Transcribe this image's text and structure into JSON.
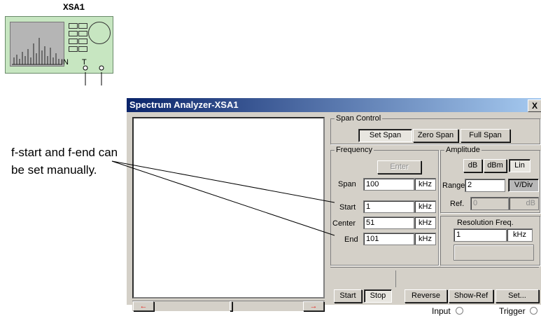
{
  "instrument": {
    "label": "XSA1",
    "terminal_in": "IN",
    "terminal_t": "T"
  },
  "window": {
    "title": "Spectrum Analyzer-XSA1",
    "close_label": "X",
    "span_control": {
      "legend": "Span Control",
      "buttons": [
        {
          "label": "Set Span",
          "active": true
        },
        {
          "label": "Zero Span",
          "active": false
        },
        {
          "label": "Full Span",
          "active": false
        }
      ]
    },
    "frequency": {
      "legend": "Frequency",
      "enter_label": "Enter",
      "rows": [
        {
          "label": "Span",
          "value": "100",
          "unit": "kHz"
        },
        {
          "label": "Start",
          "value": "1",
          "unit": "kHz"
        },
        {
          "label": "Center",
          "value": "51",
          "unit": "kHz"
        },
        {
          "label": "End",
          "value": "101",
          "unit": "kHz"
        }
      ]
    },
    "amplitude": {
      "legend": "Amplitude",
      "modes": [
        {
          "label": "dB",
          "active": false
        },
        {
          "label": "dBm",
          "active": false
        },
        {
          "label": "Lin",
          "active": true
        }
      ],
      "range_label": "Range",
      "range_value": "2",
      "range_unit": "V/Div",
      "ref_label": "Ref.",
      "ref_value": "0",
      "ref_unit": "dB"
    },
    "resolution": {
      "legend": "Resolution Freq.",
      "value": "1",
      "unit": "kHz"
    },
    "controls": {
      "start": "Start",
      "stop": "Stop",
      "reverse": "Reverse",
      "show_ref": "Show-Ref",
      "set": "Set..."
    },
    "footer": {
      "input_label": "Input",
      "trigger_label": "Trigger"
    },
    "scroll": {
      "left_arrow": "←",
      "right_arrow": "→"
    }
  },
  "annotation": "f-start and f-end can be set manually.",
  "colors": {
    "titlebar": "#0a246a",
    "window_bg": "#d4d0c8",
    "scroll_arrow": "#e8231f"
  }
}
